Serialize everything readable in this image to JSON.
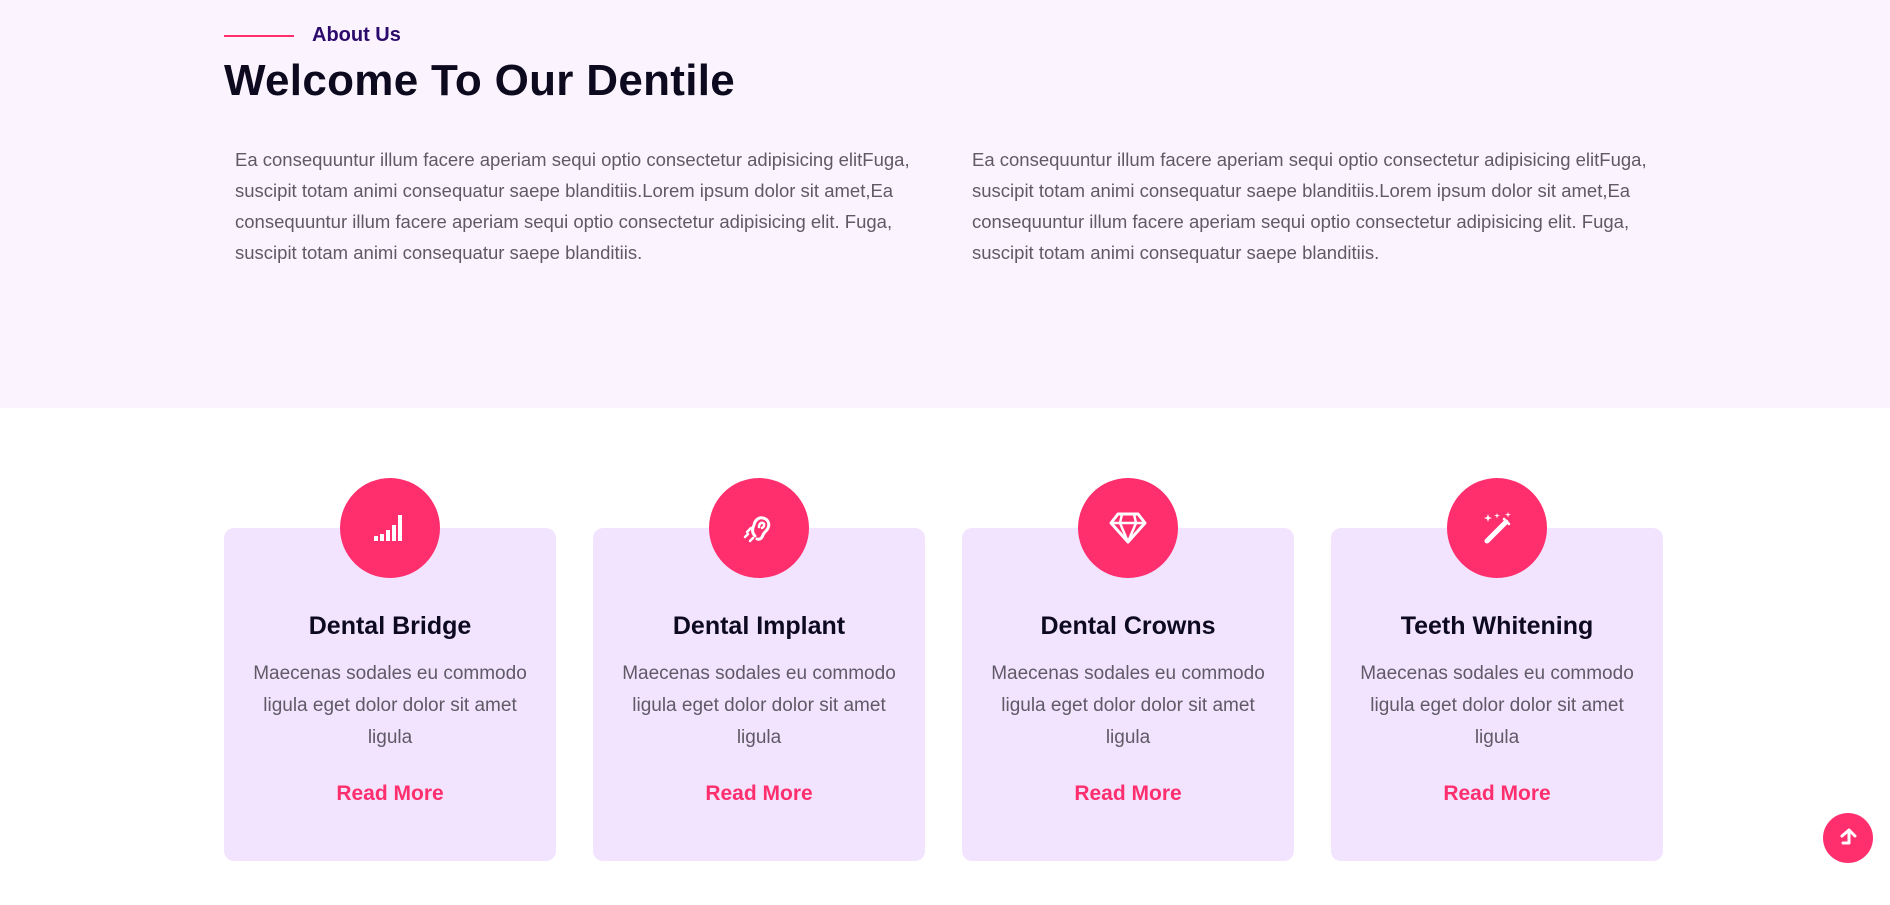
{
  "about": {
    "tag_label": "About Us",
    "title": "Welcome To Our Dentile",
    "paragraph_left": "Ea consequuntur illum facere aperiam sequi optio consectetur adipisicing elitFuga, suscipit totam animi consequatur saepe blanditiis.Lorem ipsum dolor sit amet,Ea consequuntur illum facere aperiam sequi optio consectetur adipisicing elit. Fuga, suscipit totam animi consequatur saepe blanditiis.",
    "paragraph_right": "Ea consequuntur illum facere aperiam sequi optio consectetur adipisicing elitFuga, suscipit totam animi consequatur saepe blanditiis.Lorem ipsum dolor sit amet,Ea consequuntur illum facere aperiam sequi optio consectetur adipisicing elit. Fuga, suscipit totam animi consequatur saepe blanditiis."
  },
  "services": [
    {
      "icon": "signal-bars-icon",
      "title": "Dental Bridge",
      "description": "Maecenas sodales eu commodo ligula eget dolor dolor sit amet ligula",
      "link": "Read More"
    },
    {
      "icon": "hearing-ear-icon",
      "title": "Dental Implant",
      "description": "Maecenas sodales eu commodo ligula eget dolor dolor sit amet ligula",
      "link": "Read More"
    },
    {
      "icon": "diamond-icon",
      "title": "Dental Crowns",
      "description": "Maecenas sodales eu commodo ligula eget dolor dolor sit amet ligula",
      "link": "Read More"
    },
    {
      "icon": "magic-wand-icon",
      "title": "Teeth Whitening",
      "description": "Maecenas sodales eu commodo ligula eget dolor dolor sit amet ligula",
      "link": "Read More"
    }
  ],
  "scroll_top": {
    "icon": "arrow-up-icon"
  },
  "colors": {
    "accent": "#ff2f6e",
    "about_background": "#fbf4ff",
    "card_background": "#f2e4ff",
    "heading": "#0d0a1f",
    "tag_label": "#2c0a6b",
    "body_text": "#5f5a66"
  }
}
